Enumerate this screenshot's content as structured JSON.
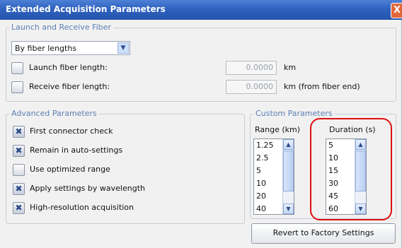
{
  "window": {
    "title": "Extended Acquisition Parameters",
    "close_glyph": "X"
  },
  "launch_group": {
    "legend": "Launch and Receive Fiber",
    "mode_select": {
      "value": "By fiber lengths"
    },
    "launch": {
      "label": "Launch fiber length:",
      "value": "0.0000",
      "unit": "km",
      "checked": false
    },
    "receive": {
      "label": "Receive fiber length:",
      "value": "0.0000",
      "unit": "km (from fiber end)",
      "checked": false
    }
  },
  "advanced": {
    "legend": "Advanced Parameters",
    "options": [
      {
        "label": "First connector check",
        "checked": true
      },
      {
        "label": "Remain in auto-settings",
        "checked": true
      },
      {
        "label": "Use optimized range",
        "checked": false
      },
      {
        "label": "Apply settings by wavelength",
        "checked": true
      },
      {
        "label": "High-resolution acquisition",
        "checked": true
      }
    ]
  },
  "custom": {
    "legend": "Custom Parameters",
    "range_header": "Range (km)",
    "range_items": [
      "1.25",
      "2.5",
      "5",
      "10",
      "20",
      "40"
    ],
    "duration_header": "Duration (s)",
    "duration_items": [
      "5",
      "10",
      "15",
      "30",
      "45",
      "60"
    ]
  },
  "revert_button": "Revert to Factory Settings",
  "colors": {
    "titlebar": "#2f62bf",
    "legend_text": "#5b7fb3",
    "highlight": "#e01010"
  }
}
